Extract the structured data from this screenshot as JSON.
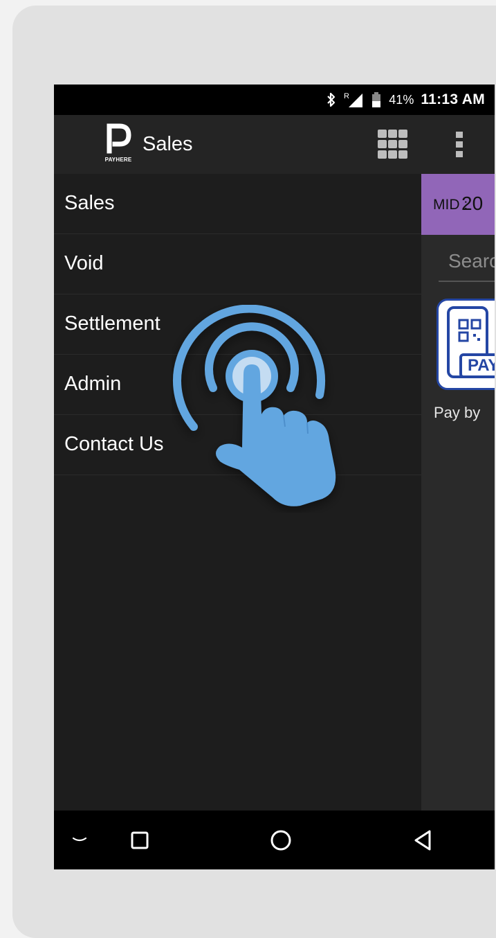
{
  "status_bar": {
    "battery_percent": "41%",
    "time": "11:13 AM",
    "icons": [
      "bluetooth-icon",
      "signal-icon",
      "battery-icon"
    ]
  },
  "app_bar": {
    "logo_text": "PAYHERE",
    "title": "Sales",
    "icons": [
      "grid-icon",
      "more-vert-icon"
    ]
  },
  "drawer": {
    "items": [
      {
        "label": "Sales"
      },
      {
        "label": "Void"
      },
      {
        "label": "Settlement"
      },
      {
        "label": "Admin"
      },
      {
        "label": "Contact Us"
      }
    ]
  },
  "content": {
    "mid_label": "MID :",
    "mid_value": "20",
    "search_placeholder": "Search",
    "tile_text": "PAY",
    "tile_label": "Pay by"
  },
  "nav_bar": {
    "icons": [
      "hide-keyboard-icon",
      "recent-apps-icon",
      "home-icon",
      "back-icon"
    ]
  },
  "overlay": {
    "icon": "tap-gesture-icon"
  },
  "colors": {
    "mid_bar": "#9166b8",
    "tap_blue": "#62a6e0",
    "tile_border": "#2446a4"
  }
}
